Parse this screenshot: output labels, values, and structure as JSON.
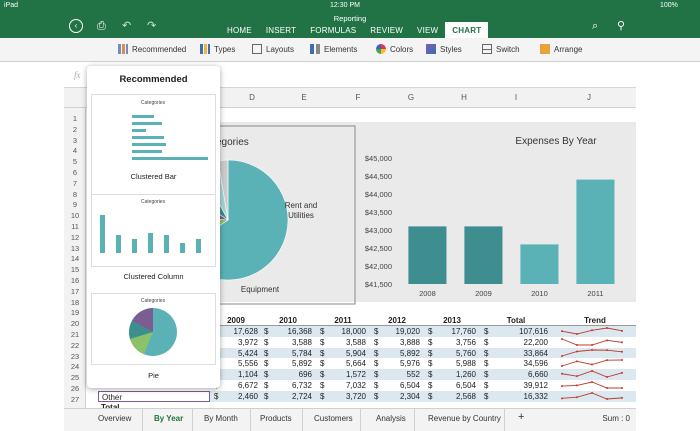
{
  "status": {
    "device": "iPad",
    "time": "12:30 PM",
    "battery": "100%"
  },
  "app": {
    "title": "Reporting"
  },
  "ribbon": {
    "tabs": [
      {
        "label": "HOME"
      },
      {
        "label": "INSERT"
      },
      {
        "label": "FORMULAS"
      },
      {
        "label": "REVIEW"
      },
      {
        "label": "VIEW"
      },
      {
        "label": "CHART"
      }
    ],
    "active_tab": "CHART"
  },
  "toolbar": {
    "items": [
      {
        "label": "Recommended"
      },
      {
        "label": "Types"
      },
      {
        "label": "Layouts"
      },
      {
        "label": "Elements"
      },
      {
        "label": "Colors"
      },
      {
        "label": "Styles"
      },
      {
        "label": "Switch"
      },
      {
        "label": "Arrange"
      }
    ]
  },
  "formula": {
    "fx": "fx"
  },
  "columns": [
    "D",
    "E",
    "F",
    "G",
    "H",
    "I",
    "J"
  ],
  "rows": [
    "1",
    "2",
    "3",
    "4",
    "5",
    "6",
    "7",
    "8",
    "9",
    "10",
    "11",
    "12",
    "13",
    "14",
    "15",
    "16",
    "17",
    "18",
    "19",
    "20",
    "21",
    "22",
    "23",
    "24",
    "25",
    "26",
    "27"
  ],
  "popup": {
    "title": "Recommended",
    "options": [
      {
        "label": "Clustered Bar"
      },
      {
        "label": "Clustered Column"
      },
      {
        "label": "Pie"
      }
    ],
    "thumb_title": "Categories"
  },
  "pie_chart": {
    "title_partial": "egories",
    "labels": [
      "Rent and Utilities",
      "Equipment"
    ]
  },
  "colors": {
    "accent": "#217346",
    "teal": "#5ab2b6",
    "dark_teal": "#3f8e8f",
    "green": "#8bc169",
    "purple": "#7b5c93"
  },
  "chart_data": [
    {
      "type": "bar",
      "title": "Expenses By Year",
      "categories": [
        "2008",
        "2009",
        "2010",
        "2011"
      ],
      "values": [
        43100,
        43100,
        42600,
        44400
      ],
      "ylim": [
        41500,
        45000
      ],
      "yticks": [
        "$41,500",
        "$42,000",
        "$42,500",
        "$43,000",
        "$43,500",
        "$44,000",
        "$44,500",
        "$45,000"
      ]
    },
    {
      "type": "pie",
      "labels": [
        "Rent and Utilities",
        "Equipment"
      ],
      "values": [
        50,
        8,
        6,
        6,
        4,
        2
      ]
    }
  ],
  "table": {
    "headers": [
      "2009",
      "2010",
      "2011",
      "2012",
      "2013",
      "Total",
      "Trend"
    ],
    "rows": [
      {
        "vals": [
          "17,628",
          "16,368",
          "18,000",
          "19,020",
          "17,760",
          "107,616"
        ]
      },
      {
        "vals": [
          "3,972",
          "3,588",
          "3,588",
          "3,888",
          "3,756",
          "22,200"
        ]
      },
      {
        "vals": [
          "5,424",
          "5,784",
          "5,904",
          "5,892",
          "5,760",
          "33,864"
        ]
      },
      {
        "vals": [
          "5,556",
          "5,892",
          "5,664",
          "5,976",
          "5,988",
          "34,596"
        ]
      },
      {
        "vals": [
          "1,104",
          "696",
          "1,572",
          "552",
          "1,260",
          "6,660"
        ]
      },
      {
        "vals": [
          "6,672",
          "6,732",
          "7,032",
          "6,504",
          "6,504",
          "39,912"
        ]
      },
      {
        "vals": [
          "2,460",
          "2,724",
          "3,720",
          "2,304",
          "2,568",
          "16,332"
        ]
      }
    ],
    "row26_label": "Other",
    "row26_first": "2,460",
    "row27_label": "Total"
  },
  "sheets": {
    "tabs": [
      {
        "label": "Overview"
      },
      {
        "label": "By Year"
      },
      {
        "label": "By Month"
      },
      {
        "label": "Products"
      },
      {
        "label": "Customers"
      },
      {
        "label": "Analysis"
      },
      {
        "label": "Revenue by Country"
      }
    ],
    "active": "By Year",
    "add": "+",
    "sum": "Sum : 0"
  }
}
